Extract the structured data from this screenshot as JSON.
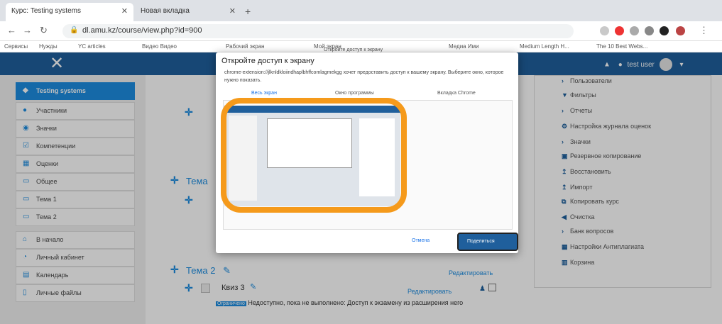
{
  "browser": {
    "tabs": [
      {
        "title": "Курс: Testing systems"
      },
      {
        "title": "Новая вкладка"
      }
    ],
    "url": "dl.amu.kz/course/view.php?id=900",
    "bookmarks": [
      "Сервисы",
      "Нужды",
      "YC articles",
      "Видео Видео",
      "Рабочий экран",
      "Мой экран",
      "Медиа Ими",
      "Medium Length H...",
      "The 10 Best Webs..."
    ],
    "share_tooltip": "Откройте доступ к экрану"
  },
  "topbar": {
    "user_label": "test user"
  },
  "sidebar": {
    "items": [
      {
        "label": "Testing systems",
        "icon": "graduation-cap-icon",
        "glyph": "🎓"
      },
      {
        "label": "Участники",
        "icon": "users-icon",
        "glyph": "👥"
      },
      {
        "label": "Значки",
        "icon": "badge-icon",
        "glyph": "●"
      },
      {
        "label": "Компетенции",
        "icon": "checklist-icon",
        "glyph": "☑"
      },
      {
        "label": "Оценки",
        "icon": "table-icon",
        "glyph": "▦"
      },
      {
        "label": "Общее",
        "icon": "folder-icon",
        "glyph": "▭"
      },
      {
        "label": "Тема 1",
        "icon": "folder-icon",
        "glyph": "▭"
      },
      {
        "label": "Тема 2",
        "icon": "folder-icon",
        "glyph": "▭"
      },
      {
        "label": "В начало",
        "icon": "home-icon",
        "glyph": "⌂"
      },
      {
        "label": "Личный кабинет",
        "icon": "dashboard-icon",
        "glyph": "◔"
      },
      {
        "label": "Календарь",
        "icon": "calendar-icon",
        "glyph": "▤"
      },
      {
        "label": "Личные файлы",
        "icon": "file-icon",
        "glyph": "▯"
      }
    ]
  },
  "main": {
    "topic1": "Тема",
    "topic2": "Тема 2",
    "quiz": "Квиз 3",
    "edit": "Редактировать",
    "restriction_badge": "Ограничено",
    "restriction_text": "Недоступно, пока не выполнено: Доступ к экзамену из расширения него"
  },
  "right": {
    "items": [
      {
        "label": "Пользователи",
        "glyph": "›"
      },
      {
        "label": "Фильтры",
        "glyph": "▼"
      },
      {
        "label": "Отчеты",
        "glyph": "›"
      },
      {
        "label": "Настройка журнала оценок",
        "glyph": "⚙"
      },
      {
        "label": "Значки",
        "glyph": "›"
      },
      {
        "label": "Резервное копирование",
        "glyph": "▣"
      },
      {
        "label": "Восстановить",
        "glyph": "↥"
      },
      {
        "label": "Импорт",
        "glyph": "↥"
      },
      {
        "label": "Копировать курс",
        "glyph": "⧉"
      },
      {
        "label": "Очистка",
        "glyph": "◀"
      },
      {
        "label": "Банк вопросов",
        "glyph": "›"
      },
      {
        "label": "Настройки Антиплагиата",
        "glyph": "▦"
      },
      {
        "label": "Корзина",
        "glyph": "🗑"
      }
    ]
  },
  "dialog": {
    "title": "Откройте доступ к экрану",
    "description": "chrome-extension://jlknldkloiindhaplbhffcomlagmekgg хочет предоставить доступ к вашему экрану. Выберите окно, которое нужно показать.",
    "tabs": [
      "Весь экран",
      "Окно программы",
      "Вкладка Chrome"
    ],
    "cancel": "Отмена",
    "share": "Поделиться"
  },
  "colors": {
    "brand": "#1f5f9c",
    "accent": "#1d8de0",
    "highlight": "#f59a1b"
  }
}
